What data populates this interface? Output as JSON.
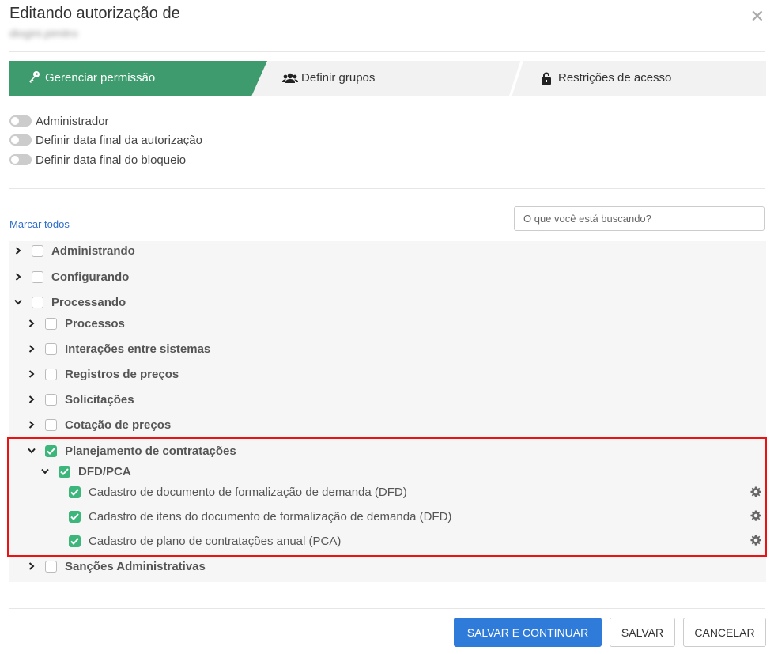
{
  "dialog": {
    "title": "Editando autorização de",
    "subtitle": "diogini.pimitro",
    "close_glyph": "✕"
  },
  "tabs": [
    {
      "label": "Gerenciar permissão",
      "icon": "key-icon",
      "active": true
    },
    {
      "label": "Definir grupos",
      "icon": "users-icon",
      "active": false
    },
    {
      "label": "Restrições de acesso",
      "icon": "lock-icon",
      "active": false
    }
  ],
  "toggles": [
    {
      "label": "Administrador",
      "on": false
    },
    {
      "label": "Definir data final da autorização",
      "on": false
    },
    {
      "label": "Definir data final do bloqueio",
      "on": false
    }
  ],
  "marcar_todos": "Marcar todos",
  "search": {
    "placeholder": "O que você está buscando?",
    "value": ""
  },
  "tree": {
    "administrando": "Administrando",
    "configurando": "Configurando",
    "processando": "Processando",
    "processos": "Processos",
    "interacoes": "Interações entre sistemas",
    "registros": "Registros de preços",
    "solicitacoes": "Solicitações",
    "cotacao": "Cotação de preços",
    "planejamento": "Planejamento de contratações",
    "dfd_pca": "DFD/PCA",
    "item_dfd": "Cadastro de documento de formalização de demanda (DFD)",
    "item_itens_dfd": "Cadastro de itens do documento de formalização de demanda (DFD)",
    "item_pca": "Cadastro de plano de contratações anual (PCA)",
    "sancoes": "Sanções Administrativas"
  },
  "colors": {
    "accent": "#3d9b6e",
    "check": "#3db67c",
    "primary": "#2f7bd9",
    "highlight": "#e11111"
  },
  "buttons": {
    "save_continue": "SALVAR E CONTINUAR",
    "save": "SALVAR",
    "cancel": "CANCELAR"
  }
}
